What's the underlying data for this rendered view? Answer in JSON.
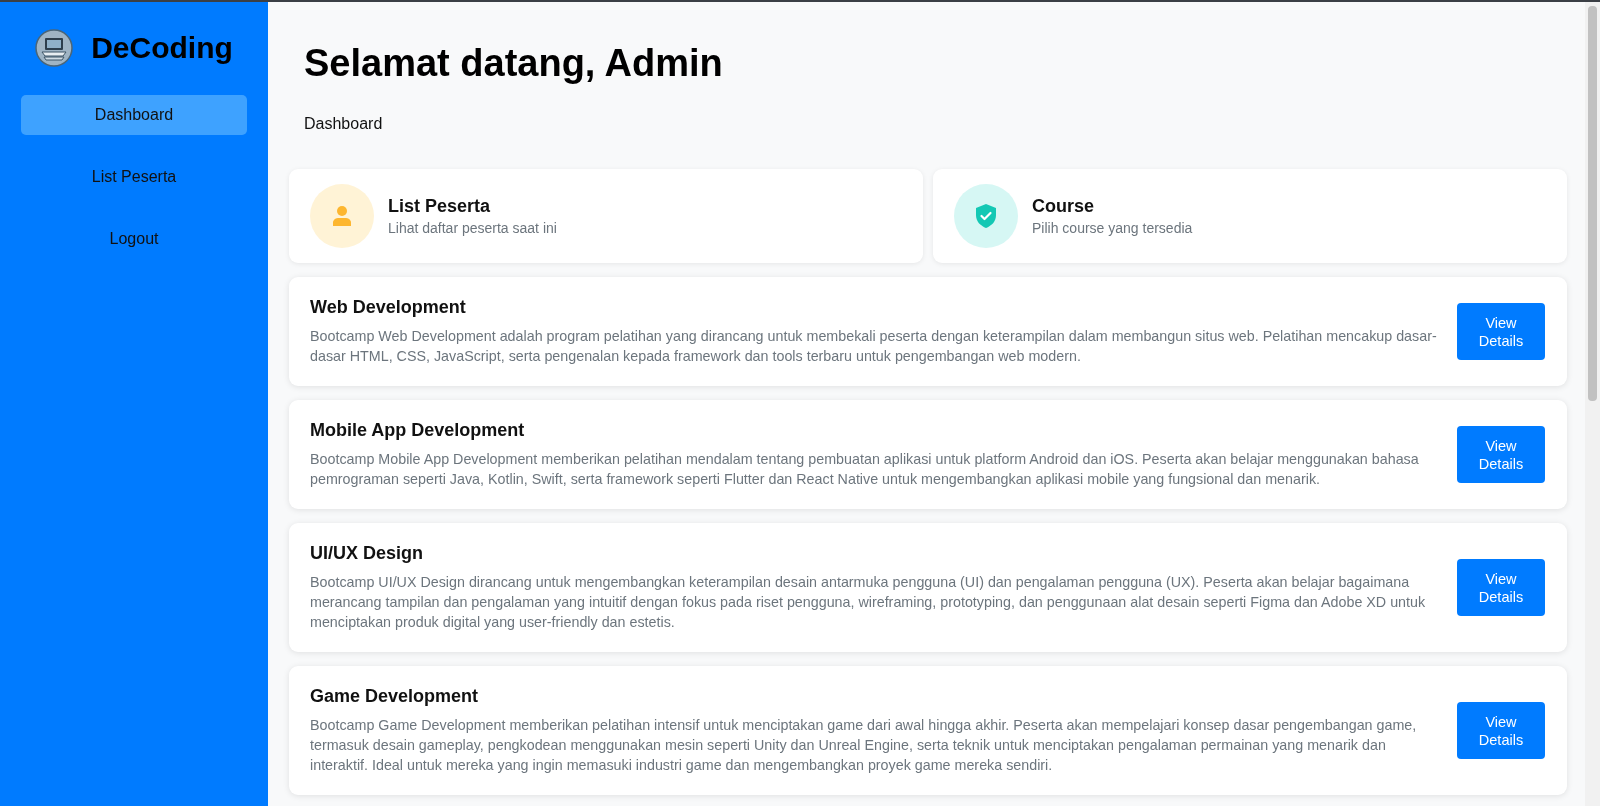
{
  "sidebar": {
    "brand": "DeCoding",
    "items": [
      {
        "label": "Dashboard",
        "selected": true
      },
      {
        "label": "List Peserta",
        "selected": false
      },
      {
        "label": "Logout",
        "selected": false
      }
    ]
  },
  "header": {
    "title": "Selamat datang, Admin",
    "breadcrumb": "Dashboard"
  },
  "summary_cards": [
    {
      "kind": "person",
      "title": "List Peserta",
      "subtitle": "Lihat daftar peserta saat ini"
    },
    {
      "kind": "shield",
      "title": "Course",
      "subtitle": "Pilih course yang tersedia"
    }
  ],
  "courses": [
    {
      "title": "Web Development",
      "description": "Bootcamp Web Development adalah program pelatihan yang dirancang untuk membekali peserta dengan keterampilan dalam membangun situs web. Pelatihan mencakup dasar-dasar HTML, CSS, JavaScript, serta pengenalan kepada framework dan tools terbaru untuk pengembangan web modern.",
      "button": "View Details"
    },
    {
      "title": "Mobile App Development",
      "description": "Bootcamp Mobile App Development memberikan pelatihan mendalam tentang pembuatan aplikasi untuk platform Android dan iOS. Peserta akan belajar menggunakan bahasa pemrograman seperti Java, Kotlin, Swift, serta framework seperti Flutter dan React Native untuk mengembangkan aplikasi mobile yang fungsional dan menarik.",
      "button": "View Details"
    },
    {
      "title": "UI/UX Design",
      "description": "Bootcamp UI/UX Design dirancang untuk mengembangkan keterampilan desain antarmuka pengguna (UI) dan pengalaman pengguna (UX). Peserta akan belajar bagaimana merancang tampilan dan pengalaman yang intuitif dengan fokus pada riset pengguna, wireframing, prototyping, dan penggunaan alat desain seperti Figma dan Adobe XD untuk menciptakan produk digital yang user-friendly dan estetis.",
      "button": "View Details"
    },
    {
      "title": "Game Development",
      "description": "Bootcamp Game Development memberikan pelatihan intensif untuk menciptakan game dari awal hingga akhir. Peserta akan mempelajari konsep dasar pengembangan game, termasuk desain gameplay, pengkodean menggunakan mesin seperti Unity dan Unreal Engine, serta teknik untuk menciptakan pengalaman permainan yang menarik dan interaktif. Ideal untuk mereka yang ingin memasuki industri game dan mengembangkan proyek game mereka sendiri.",
      "button": "View Details"
    }
  ]
}
